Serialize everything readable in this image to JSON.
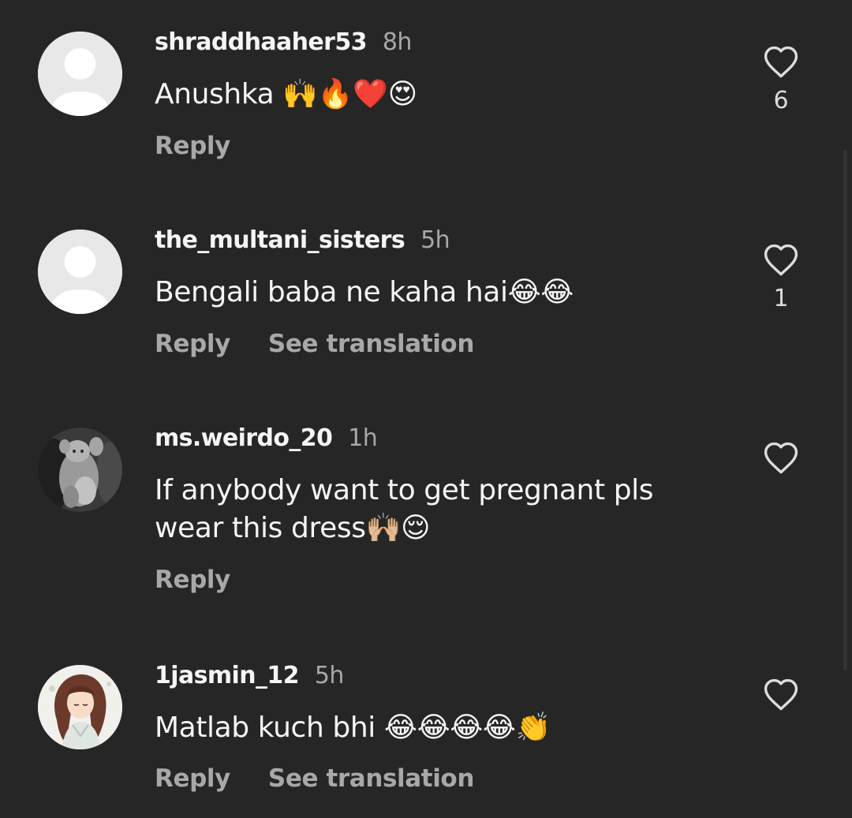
{
  "comments": [
    {
      "username": "shraddhaaher53",
      "time": "8h",
      "text": "Anushka 🙌🔥❤️😍",
      "reply_label": "Reply",
      "like_count": "6",
      "avatar": "default-avatar"
    },
    {
      "username": "the_multani_sisters",
      "time": "5h",
      "text": "Bengali baba ne kaha hai😂😂",
      "reply_label": "Reply",
      "translate_label": "See translation",
      "like_count": "1",
      "avatar": "default-avatar"
    },
    {
      "username": "ms.weirdo_20",
      "time": "1h",
      "text": "If anybody want to get pregnant pls wear this dress🙌🏼😌",
      "reply_label": "Reply",
      "avatar": "grayscale-teddy-photo"
    },
    {
      "username": "1jasmin_12",
      "time": "5h",
      "text": "Matlab kuch bhi 😂😂😂😂👏",
      "reply_label": "Reply",
      "translate_label": "See translation",
      "avatar": "anime-girl-illustration"
    }
  ],
  "icons": {
    "like": "heart-outline-icon"
  },
  "colors": {
    "background": "#262626",
    "primary_text": "#f5f5f5",
    "secondary_text": "#a8a8a8",
    "default_avatar": "#e9e9e9"
  }
}
